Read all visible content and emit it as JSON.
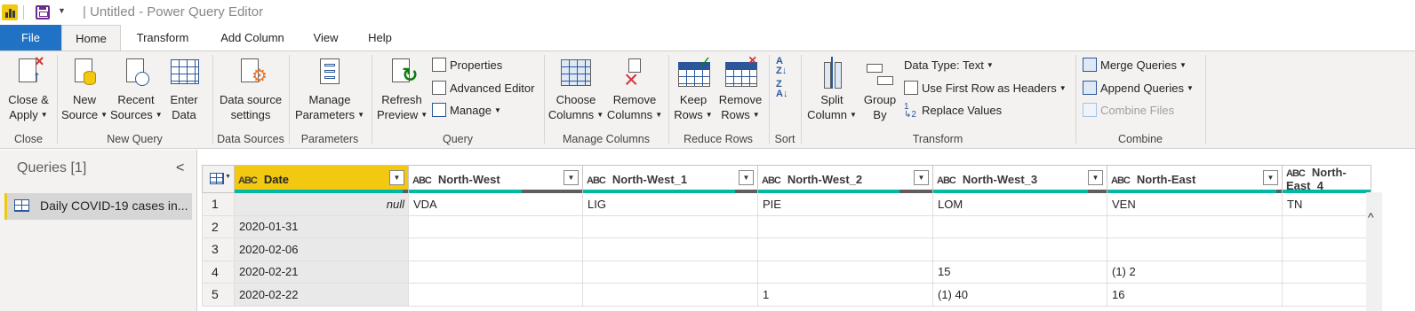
{
  "window": {
    "title": "| Untitled - Power Query Editor"
  },
  "tabs": [
    {
      "label": "File"
    },
    {
      "label": "Home"
    },
    {
      "label": "Transform"
    },
    {
      "label": "Add Column"
    },
    {
      "label": "View"
    },
    {
      "label": "Help"
    }
  ],
  "ribbon": {
    "close": {
      "label": "Close &\nApply",
      "group": "Close"
    },
    "new_query": {
      "new_source": "New\nSource",
      "recent_sources": "Recent\nSources",
      "enter_data": "Enter\nData",
      "group": "New Query"
    },
    "data_sources": {
      "settings": "Data source\nsettings",
      "group": "Data Sources"
    },
    "parameters": {
      "manage": "Manage\nParameters",
      "group": "Parameters"
    },
    "query": {
      "refresh": "Refresh\nPreview",
      "properties": "Properties",
      "advanced_editor": "Advanced Editor",
      "manage": "Manage",
      "group": "Query"
    },
    "manage_columns": {
      "choose": "Choose\nColumns",
      "remove": "Remove\nColumns",
      "group": "Manage Columns"
    },
    "reduce_rows": {
      "keep": "Keep\nRows",
      "remove": "Remove\nRows",
      "group": "Reduce Rows"
    },
    "sort": {
      "group": "Sort"
    },
    "transform": {
      "split": "Split\nColumn",
      "group_by": "Group\nBy",
      "data_type": "Data Type: Text",
      "first_row": "Use First Row as Headers",
      "replace": "Replace Values",
      "group": "Transform"
    },
    "combine": {
      "merge": "Merge Queries",
      "append": "Append Queries",
      "combine_files": "Combine Files",
      "group": "Combine"
    }
  },
  "queries_pane": {
    "title": "Queries [1]",
    "items": [
      {
        "label": "Daily COVID-19 cases in..."
      }
    ]
  },
  "grid": {
    "type_glyph": "ABC",
    "columns": [
      {
        "name": "Date",
        "selected": true,
        "quality_valid": 0.97
      },
      {
        "name": "North-West",
        "selected": false,
        "quality_valid": 0.65
      },
      {
        "name": "North-West_1",
        "selected": false,
        "quality_valid": 0.87
      },
      {
        "name": "North-West_2",
        "selected": false,
        "quality_valid": 0.81
      },
      {
        "name": "North-West_3",
        "selected": false,
        "quality_valid": 0.89
      },
      {
        "name": "North-East",
        "selected": false,
        "quality_valid": 0.97
      },
      {
        "name": "North-East_4",
        "selected": false,
        "quality_valid": 1.0
      }
    ],
    "rows": [
      {
        "n": "1",
        "cells": [
          "null",
          "VDA",
          "LIG",
          "PIE",
          "LOM",
          "VEN",
          "TN"
        ]
      },
      {
        "n": "2",
        "cells": [
          "2020-01-31",
          "",
          "",
          "",
          "",
          "",
          ""
        ]
      },
      {
        "n": "3",
        "cells": [
          "2020-02-06",
          "",
          "",
          "",
          "",
          "",
          ""
        ]
      },
      {
        "n": "4",
        "cells": [
          "2020-02-21",
          "",
          "",
          "",
          "15",
          "(1) 2",
          ""
        ]
      },
      {
        "n": "5",
        "cells": [
          "2020-02-22",
          "",
          "",
          "1",
          "(1) 40",
          "16",
          ""
        ]
      }
    ]
  }
}
